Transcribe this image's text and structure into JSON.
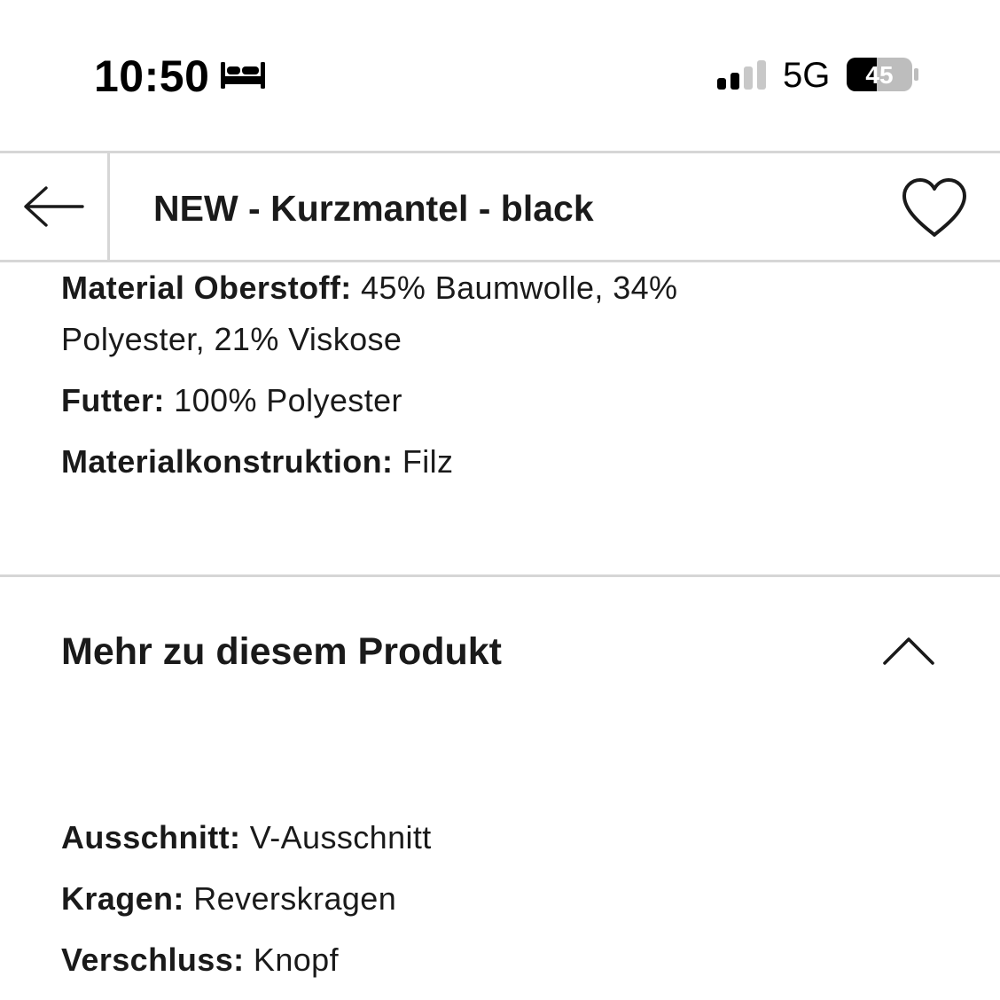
{
  "status_bar": {
    "time": "10:50",
    "focus_icon": "bed-icon",
    "signal_icon": "cellular-signal-icon",
    "network": "5G",
    "battery_level": "45"
  },
  "header": {
    "back_icon": "arrow-left-icon",
    "title": "NEW - Kurzmantel - black",
    "wishlist_icon": "heart-icon"
  },
  "material": {
    "oberstoff_key": "Material Oberstoff:",
    "oberstoff_value_line1": " 45% Baumwolle, 34%",
    "oberstoff_value_line2": "Polyester, 21% Viskose",
    "futter_key": "Futter:",
    "futter_value": " 100% Polyester",
    "konstruktion_key": "Materialkonstruktion:",
    "konstruktion_value": " Filz"
  },
  "more_section": {
    "title": "Mehr zu diesem Produkt",
    "toggle_icon": "chevron-up-icon",
    "attributes": [
      {
        "key": "Ausschnitt:",
        "value": " V-Ausschnitt"
      },
      {
        "key": "Kragen:",
        "value": " Reverskragen"
      },
      {
        "key": "Verschluss:",
        "value": " Knopf"
      }
    ]
  }
}
